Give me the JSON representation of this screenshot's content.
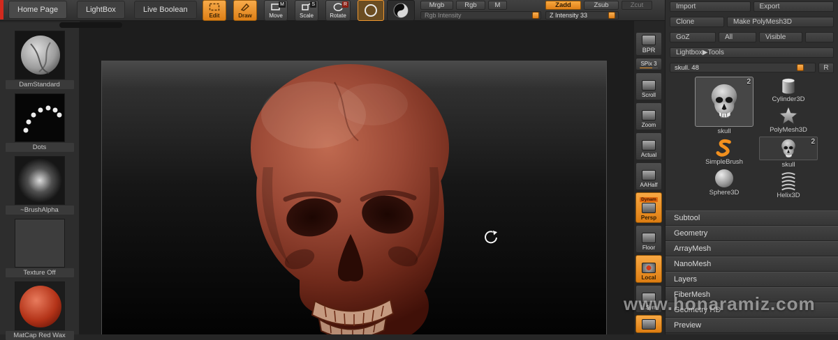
{
  "colors": {
    "accent": "#ef9430",
    "skull_material": "#94402e"
  },
  "topbar": {
    "tabs": [
      {
        "label": "Home Page"
      },
      {
        "label": "LightBox"
      },
      {
        "label": "Live Boolean"
      }
    ],
    "mode_buttons": [
      {
        "label": "Edit",
        "badge": ""
      },
      {
        "label": "Draw",
        "badge": ""
      },
      {
        "label": "Move",
        "badge": "M"
      },
      {
        "label": "Scale",
        "badge": "S"
      },
      {
        "label": "Rotate",
        "badge": "R"
      }
    ],
    "paint_buttons": [
      {
        "label": "Mrgb"
      },
      {
        "label": "Rgb"
      },
      {
        "label": "M"
      }
    ],
    "sculpt_buttons": [
      {
        "label": "Zadd"
      },
      {
        "label": "Zsub"
      },
      {
        "label": "Zcut"
      }
    ],
    "rgb_slider": {
      "label": "Rgb Intensity"
    },
    "z_slider": {
      "label": "Z Intensity 33"
    }
  },
  "left_sidebar": {
    "items": [
      {
        "label": "DamStandard"
      },
      {
        "label": "Dots"
      },
      {
        "label": "~BrushAlpha"
      },
      {
        "label": "Texture Off"
      },
      {
        "label": "MatCap Red Wax"
      }
    ]
  },
  "right_toolbar": {
    "buttons": [
      {
        "label": "BPR"
      },
      {
        "label": "SPix 3"
      },
      {
        "label": "Scroll"
      },
      {
        "label": "Zoom"
      },
      {
        "label": "Actual"
      },
      {
        "label": "AAHalf"
      },
      {
        "label": "Persp",
        "tag": "Dynam"
      },
      {
        "label": "Floor"
      },
      {
        "label": "Local"
      },
      {
        "label": "L.Sym"
      }
    ]
  },
  "right_panel": {
    "file_buttons": [
      {
        "label": "Import"
      },
      {
        "label": "Export"
      }
    ],
    "clone_row": [
      {
        "label": "Clone"
      },
      {
        "label": "Make PolyMesh3D"
      }
    ],
    "goz_row": [
      {
        "label": "GoZ"
      },
      {
        "label": "All"
      },
      {
        "label": "Visible"
      }
    ],
    "lightbox_tools": "Lightbox▶Tools",
    "tool_slider": {
      "label": "skull. 48",
      "reset": "R"
    },
    "tools_left": [
      {
        "label": "skull",
        "badge": "2"
      },
      {
        "label": "SimpleBrush"
      },
      {
        "label": "Sphere3D"
      }
    ],
    "tools_right": [
      {
        "label": "Cylinder3D"
      },
      {
        "label": "PolyMesh3D"
      },
      {
        "label": "skull",
        "badge": "2"
      },
      {
        "label": "Helix3D"
      }
    ],
    "menu_items": [
      "Subtool",
      "Geometry",
      "ArrayMesh",
      "NanoMesh",
      "Layers",
      "FiberMesh",
      "Geometry HD",
      "Preview"
    ]
  },
  "watermark": "www.honaramiz.com"
}
